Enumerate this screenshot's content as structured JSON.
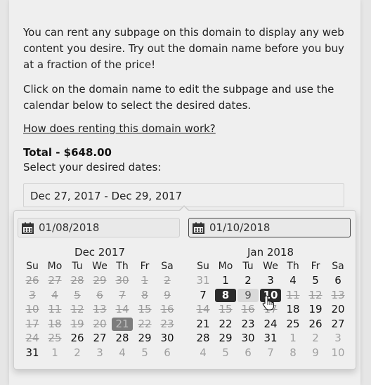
{
  "intro": {
    "paragraph1": "You can rent any subpage on this domain to display any web content you desire. Try out the domain name before you buy at a fraction of the price!",
    "paragraph2": "Click on the domain name to edit the subpage and use the calendar below to select the desired dates.",
    "help_link": "How does renting this domain work?"
  },
  "total": "Total - $648.00",
  "select_label": "Select your desired dates:",
  "date_range": "Dec 27, 2017 - Dec 29, 2017",
  "picker": {
    "start_value": "01/08/2018",
    "end_value": "01/10/2018",
    "dow": [
      "Su",
      "Mo",
      "Tu",
      "We",
      "Th",
      "Fr",
      "Sa"
    ],
    "months": [
      {
        "title": "Dec 2017",
        "weeks": [
          [
            {
              "d": "26",
              "s": "dis"
            },
            {
              "d": "27",
              "s": "dis"
            },
            {
              "d": "28",
              "s": "dis"
            },
            {
              "d": "29",
              "s": "dis"
            },
            {
              "d": "30",
              "s": "dis"
            },
            {
              "d": "1",
              "s": "dis"
            },
            {
              "d": "2",
              "s": "dis"
            }
          ],
          [
            {
              "d": "3",
              "s": "dis"
            },
            {
              "d": "4",
              "s": "dis"
            },
            {
              "d": "5",
              "s": "dis"
            },
            {
              "d": "6",
              "s": "dis"
            },
            {
              "d": "7",
              "s": "dis"
            },
            {
              "d": "8",
              "s": "dis"
            },
            {
              "d": "9",
              "s": "dis"
            }
          ],
          [
            {
              "d": "10",
              "s": "dis"
            },
            {
              "d": "11",
              "s": "dis"
            },
            {
              "d": "12",
              "s": "dis"
            },
            {
              "d": "13",
              "s": "dis"
            },
            {
              "d": "14",
              "s": "dis"
            },
            {
              "d": "15",
              "s": "dis"
            },
            {
              "d": "16",
              "s": "dis"
            }
          ],
          [
            {
              "d": "17",
              "s": "dis"
            },
            {
              "d": "18",
              "s": "dis"
            },
            {
              "d": "19",
              "s": "dis"
            },
            {
              "d": "20",
              "s": "dis"
            },
            {
              "d": "21",
              "s": "today"
            },
            {
              "d": "22",
              "s": "dis"
            },
            {
              "d": "23",
              "s": "dis"
            }
          ],
          [
            {
              "d": "24",
              "s": "dis"
            },
            {
              "d": "25",
              "s": "dis"
            },
            {
              "d": "26",
              "s": ""
            },
            {
              "d": "27",
              "s": ""
            },
            {
              "d": "28",
              "s": ""
            },
            {
              "d": "29",
              "s": ""
            },
            {
              "d": "30",
              "s": ""
            }
          ],
          [
            {
              "d": "31",
              "s": ""
            },
            {
              "d": "1",
              "s": "off"
            },
            {
              "d": "2",
              "s": "off"
            },
            {
              "d": "3",
              "s": "off"
            },
            {
              "d": "4",
              "s": "off"
            },
            {
              "d": "5",
              "s": "off"
            },
            {
              "d": "6",
              "s": "off"
            }
          ]
        ]
      },
      {
        "title": "Jan 2018",
        "weeks": [
          [
            {
              "d": "31",
              "s": "off"
            },
            {
              "d": "1",
              "s": ""
            },
            {
              "d": "2",
              "s": ""
            },
            {
              "d": "3",
              "s": ""
            },
            {
              "d": "4",
              "s": ""
            },
            {
              "d": "5",
              "s": ""
            },
            {
              "d": "6",
              "s": ""
            }
          ],
          [
            {
              "d": "7",
              "s": ""
            },
            {
              "d": "8",
              "s": "sel"
            },
            {
              "d": "9",
              "s": "inrange"
            },
            {
              "d": "10",
              "s": "sel"
            },
            {
              "d": "11",
              "s": "dis"
            },
            {
              "d": "12",
              "s": "dis"
            },
            {
              "d": "13",
              "s": "dis"
            }
          ],
          [
            {
              "d": "14",
              "s": "dis"
            },
            {
              "d": "15",
              "s": "dis"
            },
            {
              "d": "16",
              "s": "dis"
            },
            {
              "d": "17",
              "s": "dis"
            },
            {
              "d": "18",
              "s": ""
            },
            {
              "d": "19",
              "s": ""
            },
            {
              "d": "20",
              "s": ""
            }
          ],
          [
            {
              "d": "21",
              "s": ""
            },
            {
              "d": "22",
              "s": ""
            },
            {
              "d": "23",
              "s": ""
            },
            {
              "d": "24",
              "s": ""
            },
            {
              "d": "25",
              "s": ""
            },
            {
              "d": "26",
              "s": ""
            },
            {
              "d": "27",
              "s": ""
            }
          ],
          [
            {
              "d": "28",
              "s": ""
            },
            {
              "d": "29",
              "s": ""
            },
            {
              "d": "30",
              "s": ""
            },
            {
              "d": "31",
              "s": ""
            },
            {
              "d": "1",
              "s": "off"
            },
            {
              "d": "2",
              "s": "off"
            },
            {
              "d": "3",
              "s": "off"
            }
          ],
          [
            {
              "d": "4",
              "s": "off"
            },
            {
              "d": "5",
              "s": "off"
            },
            {
              "d": "6",
              "s": "off"
            },
            {
              "d": "7",
              "s": "off"
            },
            {
              "d": "8",
              "s": "off"
            },
            {
              "d": "9",
              "s": "off"
            },
            {
              "d": "10",
              "s": "off"
            }
          ]
        ]
      }
    ]
  },
  "icons": {
    "calendar": "calendar-icon",
    "cursor": "hand-pointer-cursor"
  }
}
